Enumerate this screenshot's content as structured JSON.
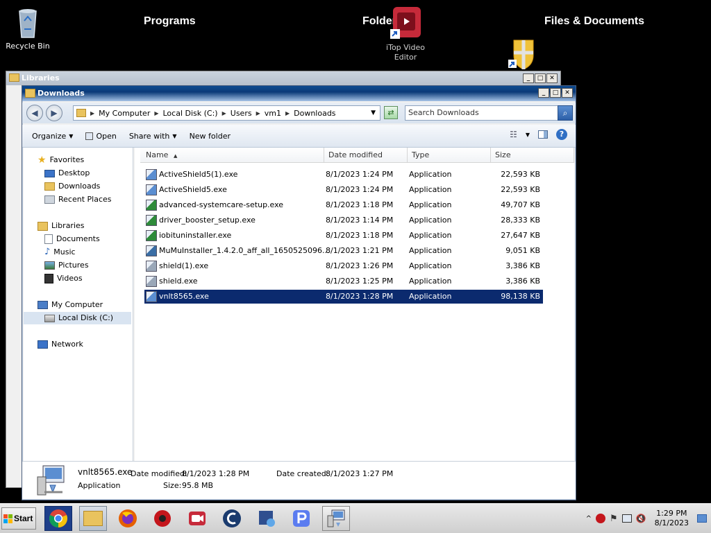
{
  "desktop": {
    "recycle_bin": "Recycle Bin",
    "categories": [
      "Programs",
      "Folders",
      "Files & Documents"
    ],
    "itop_label_1": "iTop Video",
    "itop_label_2": "Editor"
  },
  "back_window": {
    "title": "Libraries"
  },
  "window": {
    "title": "Downloads",
    "breadcrumbs": [
      "My Computer",
      "Local Disk (C:)",
      "Users",
      "vm1",
      "Downloads"
    ],
    "search_placeholder": "Search Downloads",
    "toolbar": {
      "organize": "Organize",
      "open": "Open",
      "share_with": "Share with",
      "new_folder": "New folder"
    },
    "nav": {
      "favorites": "Favorites",
      "desktop": "Desktop",
      "downloads": "Downloads",
      "recent_places": "Recent Places",
      "libraries": "Libraries",
      "documents": "Documents",
      "music": "Music",
      "pictures": "Pictures",
      "videos": "Videos",
      "my_computer": "My Computer",
      "local_disk": "Local Disk (C:)",
      "network": "Network"
    },
    "columns": {
      "name": "Name",
      "date": "Date modified",
      "type": "Type",
      "size": "Size"
    },
    "files": [
      {
        "name": "ActiveShield5(1).exe",
        "date": "8/1/2023 1:24 PM",
        "type": "Application",
        "size": "22,593 KB"
      },
      {
        "name": "ActiveShield5.exe",
        "date": "8/1/2023 1:24 PM",
        "type": "Application",
        "size": "22,593 KB"
      },
      {
        "name": "advanced-systemcare-setup.exe",
        "date": "8/1/2023 1:18 PM",
        "type": "Application",
        "size": "49,707 KB"
      },
      {
        "name": "driver_booster_setup.exe",
        "date": "8/1/2023 1:14 PM",
        "type": "Application",
        "size": "28,333 KB"
      },
      {
        "name": "iobituninstaller.exe",
        "date": "8/1/2023 1:18 PM",
        "type": "Application",
        "size": "27,647 KB"
      },
      {
        "name": "MuMuInstaller_1.4.2.0_aff_all_1650525096...",
        "date": "8/1/2023 1:21 PM",
        "type": "Application",
        "size": "9,051 KB"
      },
      {
        "name": "shield(1).exe",
        "date": "8/1/2023 1:26 PM",
        "type": "Application",
        "size": "3,386 KB"
      },
      {
        "name": "shield.exe",
        "date": "8/1/2023 1:25 PM",
        "type": "Application",
        "size": "3,386 KB"
      },
      {
        "name": "vnlt8565.exe",
        "date": "8/1/2023 1:28 PM",
        "type": "Application",
        "size": "98,138 KB"
      }
    ],
    "details": {
      "filename": "vnlt8565.exe",
      "type": "Application",
      "modified_label": "Date modified:",
      "modified_value": "8/1/2023 1:28 PM",
      "created_label": "Date created:",
      "created_value": "8/1/2023 1:27 PM",
      "size_label": "Size:",
      "size_value": "95.8 MB"
    }
  },
  "taskbar": {
    "start": "Start",
    "clock_time": "1:29 PM",
    "clock_date": "8/1/2023"
  },
  "colors": {
    "selection": "#0b2a6e",
    "title_active": "#0d4a8f"
  }
}
